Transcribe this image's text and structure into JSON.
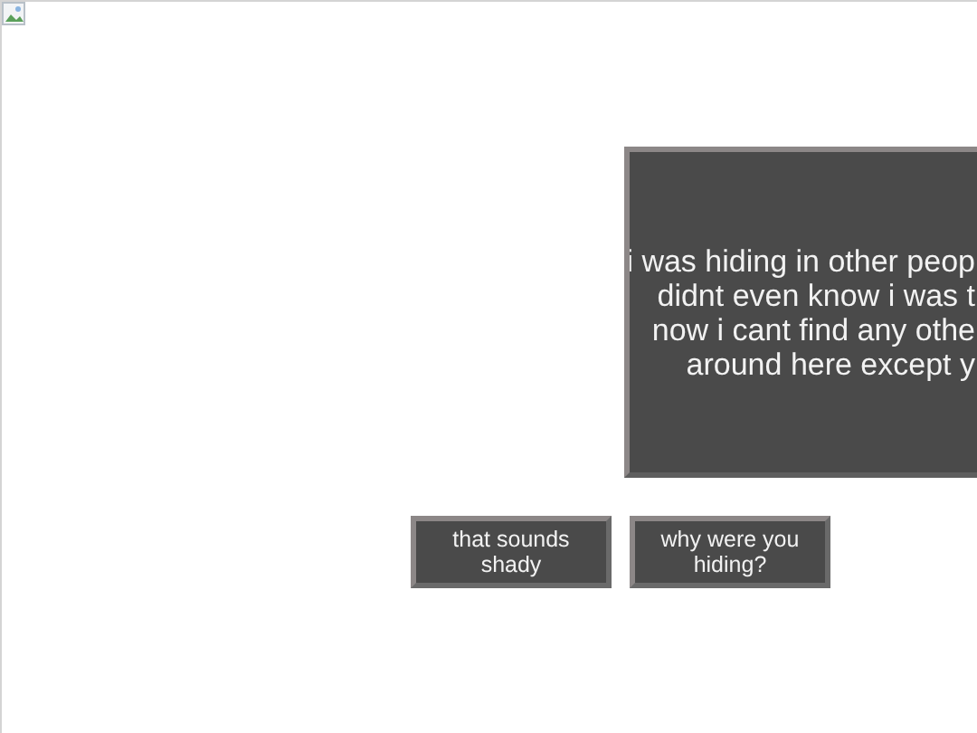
{
  "dialog": {
    "lines": [
      "i was hiding in other peop",
      "didnt even know i was t",
      "now i cant find any othe",
      "around here except y"
    ]
  },
  "choices": [
    {
      "label": "that sounds shady"
    },
    {
      "label": "why were you hiding?"
    }
  ]
}
